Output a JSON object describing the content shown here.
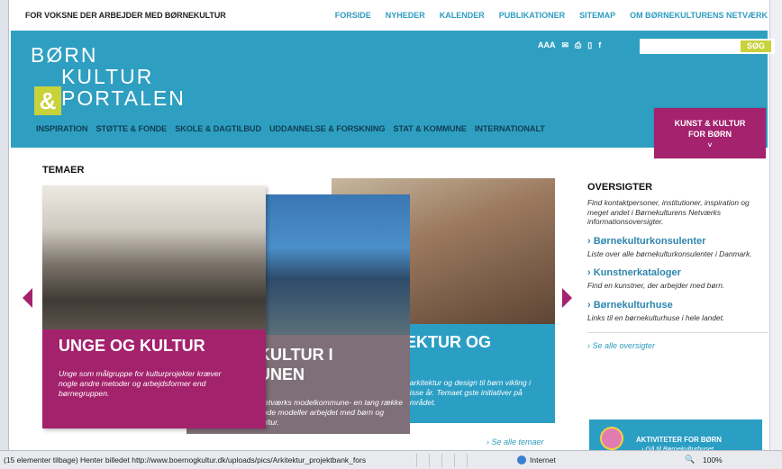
{
  "topbar": {
    "tagline": "FOR VOKSNE DER ARBEJDER MED BØRNEKULTUR",
    "nav": [
      "FORSIDE",
      "NYHEDER",
      "KALENDER",
      "PUBLIKATIONER",
      "SITEMAP",
      "OM BØRNEKULTURENS NETVÆRK"
    ]
  },
  "header": {
    "logo": {
      "line1": "BØRN",
      "line2": "KULTUR",
      "amp": "&",
      "line3": "PORTALEN"
    },
    "tools": {
      "text_size": "AAA",
      "mail_icon": "✉",
      "print_icon": "⎙",
      "comment_icon": "▯",
      "facebook_icon": "f"
    },
    "search": {
      "placeholder": "",
      "button": "SØG"
    },
    "main_nav": [
      "INSPIRATION",
      "STØTTE & FONDE",
      "SKOLE & DAGTILBUD",
      "UDDANNELSE & FORSKNING",
      "STAT & KOMMUNE",
      "INTERNATIONALT"
    ],
    "kunst_button": {
      "line1": "KUNST & KULTUR",
      "line2": "FOR BØRN",
      "chevron": "˅"
    }
  },
  "themes": {
    "title": "TEMAER",
    "cards": [
      {
        "title": "UNGE OG KULTUR",
        "text": "Unge som målgruppe for kulturprojekter kræver nogle andre metoder og arbejdsformer end børnegruppen."
      },
      {
        "title_line1": "KULTUR I",
        "title_line2": "UNEN",
        "text": "Netværks modelkommune- en lang række gode modeller arbejdet med børn og kultur."
      },
      {
        "title": "EKTUR OG",
        "text": "f arkitektur og design til børn vikling i disse år. Temaet gste initiativer på området."
      }
    ],
    "see_all": "› Se alle temaer"
  },
  "sidebar": {
    "heading": "OVERSIGTER",
    "intro": "Find kontaktpersoner, institutioner, inspiration og meget andet i Børnekulturens Netværks informationsoversigter.",
    "items": [
      {
        "title": "› Børnekulturkonsulenter",
        "desc": "Liste over alle børnekulturkonsulenter i Danmark."
      },
      {
        "title": "› Kunstnerkataloger",
        "desc": "Find en kunstner, der arbejder med børn."
      },
      {
        "title": "› Børnekulturhuse",
        "desc": "Links til en børnekulturhuse i hele landet."
      }
    ],
    "see_all": "› Se alle oversigter"
  },
  "activity": {
    "title": "AKTIVITETER FOR BØRN",
    "sub": "› Gå til Børnekulturhuset"
  },
  "statusbar": {
    "message": "(15 elementer tilbage) Henter billedet http://www.boernogkultur.dk/uploads/pics/Arkitektur_projektbank_fors",
    "zone": "Internet",
    "zoom": "100%",
    "zoom_icon": "🔍"
  },
  "colors": {
    "brand_blue": "#2f9fc1",
    "brand_magenta": "#a5226e",
    "brand_green": "#c9d23a"
  }
}
